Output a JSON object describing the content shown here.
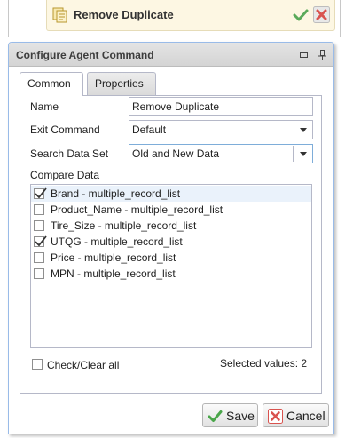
{
  "node": {
    "title": "Remove Duplicate"
  },
  "panel": {
    "title": "Configure Agent Command"
  },
  "tabs": [
    {
      "label": "Common",
      "active": true
    },
    {
      "label": "Properties",
      "active": false
    }
  ],
  "form": {
    "name_label": "Name",
    "name_value": "Remove Duplicate",
    "exit_label": "Exit Command",
    "exit_value": "Default",
    "search_label": "Search Data Set",
    "search_value": "Old and New Data",
    "compare_label": "Compare Data"
  },
  "compare_items": [
    {
      "label": "Brand - multiple_record_list",
      "checked": true
    },
    {
      "label": "Product_Name - multiple_record_list",
      "checked": false
    },
    {
      "label": "Tire_Size - multiple_record_list",
      "checked": false
    },
    {
      "label": "UTQG - multiple_record_list",
      "checked": true
    },
    {
      "label": "Price - multiple_record_list",
      "checked": false
    },
    {
      "label": "MPN - multiple_record_list",
      "checked": false
    }
  ],
  "footer": {
    "check_all_label": "Check/Clear all",
    "selected_values": "Selected values: 2"
  },
  "buttons": {
    "save": "Save",
    "cancel": "Cancel"
  },
  "colors": {
    "accent_border": "#99bbe8",
    "save_icon": "#4aa64a",
    "cancel_icon": "#d9534f"
  }
}
